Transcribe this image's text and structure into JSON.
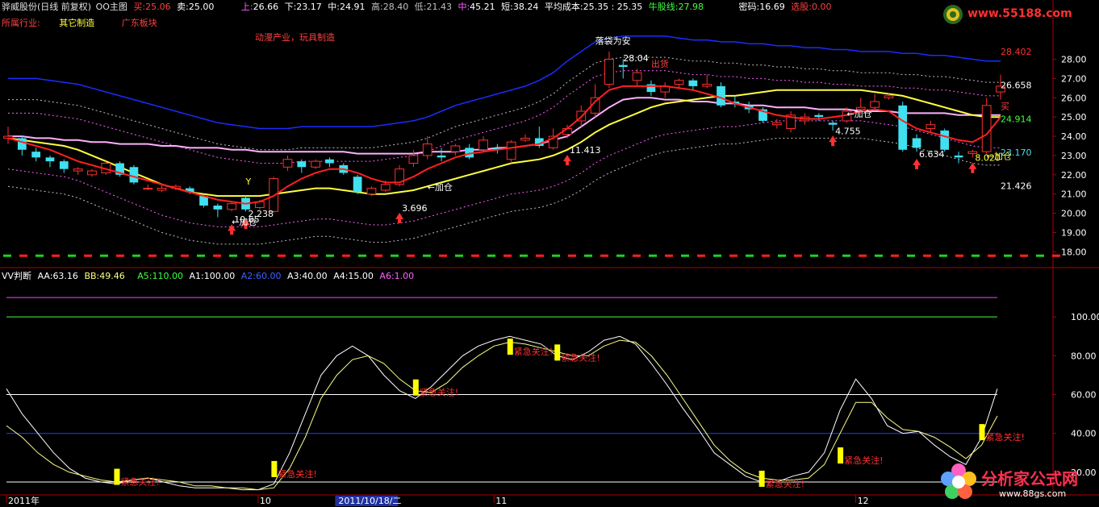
{
  "colors": {
    "bg": "#000000",
    "axis": "#b00000",
    "up": "#ff3030",
    "down": "#40e0f0",
    "ma_red": "#ff2020",
    "ma_yellow": "#ffff40",
    "ma_pink": "#ffb0ff",
    "upper_band": "#1a2cff",
    "dotted_pink": "#ff60ff",
    "dotted_white": "#c0c0c0",
    "k_line": "#ffffff",
    "d_line": "#ffff80",
    "alert": "#ffff00"
  },
  "header": {
    "stock": "骅威股份(日线 前复权)",
    "indicator": "OO主图",
    "buy_label": "买:",
    "buy_val": "25.06",
    "sell_label": "卖:",
    "sell_val": "25.00",
    "up_label": "上:",
    "up_val": "26.66",
    "down_label": "下:",
    "down_val": "23.17",
    "mid_label": "中:",
    "mid_val": "24.91",
    "high_label": "高:",
    "high_val": "28.40",
    "low_label": "低:",
    "low_val": "21.43",
    "zhong_label": "中:",
    "zhong_val": "45.21",
    "short_label": "短:",
    "short_val": "38.24",
    "avgcost_label": "平均成本:",
    "avgcost_val": "25.35 : 25.35",
    "bull_label": "牛股线:",
    "bull_val": "27.98",
    "code_label": "密码:",
    "code_val": "16.69",
    "pick_label": "选股:",
    "pick_val": "0.00"
  },
  "industry": {
    "label": "所属行业:",
    "value": "其它制造",
    "sector": "广东板块",
    "concept": "动漫产业，玩具制造"
  },
  "logo_top": "www.55188.com",
  "logo_bottom": {
    "brand": "分析家公式网",
    "url": "www.88gs.com"
  },
  "lower_header": {
    "name": "VV判断",
    "aa_label": "AA:",
    "aa_val": "63.16",
    "bb_label": "BB:",
    "bb_val": "49.46",
    "a5_label": "A5:",
    "a5_val": "110.00",
    "a1_label": "A1:",
    "a1_val": "100.00",
    "a2_label": "A2:",
    "a2_val": "60.00",
    "a3_label": "A3:",
    "a3_val": "40.00",
    "a4_label": "A4:",
    "a4_val": "15.00",
    "a6_label": "A6:",
    "a6_val": "1.00"
  },
  "chart_data": [
    {
      "type": "candlestick",
      "y_ticks": [
        "28.00",
        "27.00",
        "26.00",
        "25.00",
        "24.00",
        "23.00",
        "22.00",
        "21.00",
        "20.00",
        "19.00",
        "18.00"
      ],
      "ylim": [
        17.6,
        29.4
      ],
      "price_labels": [
        {
          "text": "28.402",
          "value": 28.4,
          "color": "#ff3030"
        },
        {
          "text": "26.658",
          "value": 26.66,
          "color": "#ffffff"
        },
        {
          "text": "24.914",
          "value": 24.91,
          "color": "#40ff40"
        },
        {
          "text": "23.170",
          "value": 23.17,
          "color": "#40e0f0"
        },
        {
          "text": "21.426",
          "value": 21.43,
          "color": "#ffffff"
        }
      ],
      "candles": [
        [
          23.9,
          24.0,
          24.5,
          23.6
        ],
        [
          23.9,
          23.3,
          24.0,
          23.0
        ],
        [
          23.2,
          22.9,
          23.4,
          22.7
        ],
        [
          22.9,
          22.7,
          23.0,
          22.4
        ],
        [
          22.7,
          22.3,
          22.8,
          22.1
        ],
        [
          22.2,
          22.3,
          22.4,
          22.0
        ],
        [
          22.0,
          22.2,
          22.3,
          21.9
        ],
        [
          22.1,
          22.6,
          22.7,
          22.0
        ],
        [
          22.6,
          22.0,
          22.7,
          21.9
        ],
        [
          22.4,
          21.6,
          22.5,
          21.5
        ],
        [
          21.3,
          21.3,
          21.5,
          21.2
        ],
        [
          21.2,
          21.3,
          21.5,
          21.1
        ],
        [
          21.3,
          21.4,
          21.5,
          21.2
        ],
        [
          21.3,
          21.1,
          21.4,
          21.0
        ],
        [
          20.9,
          20.4,
          21.0,
          20.3
        ],
        [
          20.4,
          20.2,
          20.5,
          19.8
        ],
        [
          20.2,
          20.5,
          20.6,
          20.1
        ],
        [
          20.8,
          20.2,
          20.9,
          20.1
        ],
        [
          20.3,
          20.6,
          20.7,
          20.2
        ],
        [
          20.1,
          21.8,
          21.9,
          20.0
        ],
        [
          22.4,
          22.8,
          23.0,
          22.2
        ],
        [
          22.7,
          22.4,
          22.8,
          22.1
        ],
        [
          22.4,
          22.7,
          22.8,
          22.3
        ],
        [
          22.8,
          22.6,
          22.9,
          22.4
        ],
        [
          22.5,
          22.1,
          22.6,
          22.0
        ],
        [
          21.9,
          21.1,
          22.0,
          21.0
        ],
        [
          21.0,
          21.3,
          21.4,
          20.9
        ],
        [
          21.2,
          21.5,
          21.7,
          21.1
        ],
        [
          21.5,
          22.3,
          22.5,
          21.4
        ],
        [
          22.6,
          23.0,
          23.3,
          22.4
        ],
        [
          23.0,
          23.6,
          24.0,
          22.8
        ],
        [
          23.0,
          22.9,
          23.4,
          22.7
        ],
        [
          23.2,
          23.5,
          23.6,
          23.0
        ],
        [
          23.4,
          22.9,
          23.6,
          22.8
        ],
        [
          23.3,
          23.8,
          24.0,
          23.2
        ],
        [
          23.4,
          23.3,
          23.6,
          23.1
        ],
        [
          22.8,
          23.7,
          23.8,
          22.6
        ],
        [
          23.8,
          23.9,
          24.1,
          23.7
        ],
        [
          23.9,
          23.5,
          24.5,
          23.4
        ],
        [
          23.4,
          24.0,
          24.4,
          23.3
        ],
        [
          24.1,
          24.4,
          24.6,
          23.9
        ],
        [
          24.8,
          25.3,
          25.6,
          24.5
        ],
        [
          25.2,
          26.0,
          26.7,
          25.0
        ],
        [
          26.7,
          28.0,
          28.4,
          26.5
        ],
        [
          27.7,
          27.6,
          28.0,
          27.0
        ],
        [
          26.9,
          27.3,
          27.5,
          26.6
        ],
        [
          26.7,
          26.3,
          26.9,
          26.1
        ],
        [
          26.3,
          26.6,
          26.8,
          26.0
        ],
        [
          26.7,
          26.9,
          27.0,
          26.5
        ],
        [
          26.9,
          26.6,
          27.0,
          26.4
        ],
        [
          26.6,
          26.7,
          27.2,
          26.5
        ],
        [
          26.6,
          25.6,
          26.8,
          25.5
        ],
        [
          25.8,
          25.7,
          26.1,
          25.5
        ],
        [
          25.6,
          25.4,
          25.8,
          25.2
        ],
        [
          25.4,
          24.8,
          25.5,
          24.7
        ],
        [
          24.6,
          24.7,
          24.9,
          24.4
        ],
        [
          24.4,
          25.1,
          25.3,
          24.2
        ],
        [
          24.8,
          25.0,
          25.2,
          24.6
        ],
        [
          25.1,
          25.0,
          25.2,
          24.8
        ],
        [
          24.7,
          24.6,
          24.8,
          24.3
        ],
        [
          24.8,
          25.3,
          25.5,
          24.7
        ],
        [
          25.4,
          25.5,
          26.0,
          25.2
        ],
        [
          25.5,
          25.8,
          26.2,
          25.4
        ],
        [
          26.0,
          26.1,
          26.2,
          25.9
        ],
        [
          25.6,
          23.3,
          25.8,
          23.2
        ],
        [
          23.9,
          23.4,
          24.1,
          23.2
        ],
        [
          24.4,
          24.6,
          24.8,
          24.2
        ],
        [
          24.3,
          23.3,
          24.4,
          23.2
        ],
        [
          23.0,
          22.9,
          23.2,
          22.6
        ],
        [
          23.1,
          23.2,
          23.3,
          22.9
        ],
        [
          23.2,
          25.6,
          26.0,
          23.1
        ],
        [
          26.3,
          26.6,
          27.2,
          25.9
        ]
      ],
      "ma_red": [
        23.9,
        23.7,
        23.5,
        23.3,
        23.0,
        22.7,
        22.5,
        22.3,
        22.1,
        21.9,
        21.7,
        21.5,
        21.3,
        21.1,
        20.9,
        20.7,
        20.6,
        20.5,
        20.6,
        20.9,
        21.4,
        21.8,
        22.1,
        22.3,
        22.3,
        22.1,
        21.8,
        21.6,
        21.6,
        21.9,
        22.3,
        22.6,
        22.9,
        23.1,
        23.2,
        23.3,
        23.4,
        23.5,
        23.6,
        23.9,
        24.4,
        25.0,
        25.8,
        26.4,
        26.6,
        26.6,
        26.6,
        26.6,
        26.5,
        26.4,
        26.2,
        26.0,
        25.7,
        25.5,
        25.3,
        25.1,
        25.0,
        24.9,
        24.9,
        25.0,
        25.1,
        25.3,
        25.4,
        25.3,
        24.8,
        24.4,
        24.2,
        24.0,
        23.8,
        23.7,
        24.1,
        25.0
      ],
      "ma_yellow": [
        23.9,
        23.8,
        23.7,
        23.6,
        23.5,
        23.3,
        23.0,
        22.7,
        22.4,
        22.1,
        21.8,
        21.5,
        21.3,
        21.1,
        21.0,
        20.9,
        20.9,
        20.9,
        20.9,
        21.0,
        21.1,
        21.2,
        21.3,
        21.3,
        21.2,
        21.1,
        21.0,
        21.0,
        21.1,
        21.2,
        21.4,
        21.6,
        21.8,
        22.0,
        22.2,
        22.4,
        22.6,
        22.7,
        22.8,
        23.0,
        23.3,
        23.7,
        24.2,
        24.6,
        24.9,
        25.2,
        25.5,
        25.7,
        25.8,
        25.9,
        26.0,
        26.1,
        26.1,
        26.2,
        26.3,
        26.4,
        26.4,
        26.4,
        26.4,
        26.4,
        26.4,
        26.4,
        26.3,
        26.2,
        26.1,
        25.9,
        25.7,
        25.5,
        25.3,
        25.1,
        25.0,
        25.0
      ],
      "ma_pink": [
        24.0,
        24.0,
        23.9,
        23.9,
        23.8,
        23.8,
        23.7,
        23.7,
        23.6,
        23.6,
        23.6,
        23.5,
        23.5,
        23.4,
        23.4,
        23.4,
        23.3,
        23.3,
        23.2,
        23.2,
        23.2,
        23.2,
        23.2,
        23.2,
        23.2,
        23.1,
        23.1,
        23.1,
        23.1,
        23.1,
        23.2,
        23.2,
        23.2,
        23.3,
        23.3,
        23.4,
        23.4,
        23.5,
        23.6,
        23.8,
        24.0,
        24.5,
        25.0,
        25.5,
        25.9,
        26.0,
        26.0,
        25.9,
        25.9,
        25.8,
        25.8,
        25.7,
        25.7,
        25.6,
        25.6,
        25.5,
        25.5,
        25.5,
        25.4,
        25.4,
        25.4,
        25.3,
        25.3,
        25.3,
        25.2,
        25.2,
        25.2,
        25.2,
        25.1,
        25.1,
        25.1,
        25.1
      ],
      "upper_band": [
        27.0,
        27.0,
        27.0,
        26.9,
        26.8,
        26.7,
        26.5,
        26.3,
        26.1,
        25.9,
        25.7,
        25.5,
        25.3,
        25.1,
        24.9,
        24.7,
        24.6,
        24.5,
        24.4,
        24.4,
        24.4,
        24.5,
        24.5,
        24.5,
        24.5,
        24.5,
        24.5,
        24.6,
        24.7,
        24.8,
        25.0,
        25.3,
        25.6,
        25.8,
        26.0,
        26.2,
        26.4,
        26.6,
        26.9,
        27.3,
        27.9,
        28.4,
        28.9,
        29.1,
        29.2,
        29.2,
        29.2,
        29.2,
        29.1,
        29.0,
        29.0,
        28.9,
        28.9,
        28.8,
        28.8,
        28.7,
        28.7,
        28.6,
        28.6,
        28.5,
        28.5,
        28.4,
        28.4,
        28.4,
        28.3,
        28.3,
        28.2,
        28.2,
        28.1,
        28.0,
        27.9,
        27.9
      ],
      "markers": [
        {
          "text": "10.65",
          "bar": 16,
          "value": 19.6,
          "color": "#ffffff"
        },
        {
          "text": "2.238",
          "bar": 17,
          "value": 19.9,
          "color": "#ffffff"
        },
        {
          "text": "3.696",
          "bar": 28,
          "value": 20.2,
          "color": "#ffffff"
        },
        {
          "text": "11.413",
          "bar": 40,
          "value": 23.2,
          "color": "#ffffff"
        },
        {
          "text": "4.755",
          "bar": 59,
          "value": 24.2,
          "color": "#ffffff"
        },
        {
          "text": "6.634",
          "bar": 65,
          "value": 23.0,
          "color": "#ffffff"
        },
        {
          "text": "8.020",
          "bar": 69,
          "value": 22.8,
          "color": "#ffff40"
        }
      ],
      "notes": [
        {
          "text": "←加仓",
          "bar": 16,
          "value": 19.4,
          "color": "#ffffff"
        },
        {
          "text": "←加仓",
          "bar": 30,
          "value": 21.2,
          "color": "#ffffff"
        },
        {
          "text": "←加仓",
          "bar": 60,
          "value": 25.0,
          "color": "#ffffff"
        },
        {
          "text": "←加仓",
          "bar": 70,
          "value": 22.8,
          "color": "#ffff40"
        },
        {
          "text": "落袋为安",
          "bar": 42,
          "value": 28.8,
          "color": "#ffffff"
        },
        {
          "text": "28.04",
          "bar": 44,
          "value": 27.9,
          "color": "#ffffff"
        },
        {
          "text": "出货",
          "bar": 46,
          "value": 27.6,
          "color": "#ff4040"
        },
        {
          "text": "买",
          "bar": 71,
          "value": 25.4,
          "color": "#ff4040"
        },
        {
          "text": "Y",
          "bar": 17,
          "value": 21.5,
          "color": "#ffff40"
        }
      ]
    },
    {
      "type": "line",
      "y_ticks": [
        "100.00",
        "80.00",
        "60.00",
        "40.00",
        "20.00"
      ],
      "ylim": [
        10,
        120
      ],
      "levels": [
        {
          "name": "A5",
          "value": 110,
          "color": "#ff40ff"
        },
        {
          "name": "A1",
          "value": 100,
          "color": "#40ff40"
        },
        {
          "name": "A2",
          "value": 60,
          "color": "#ffffff"
        },
        {
          "name": "A3",
          "value": 40,
          "color": "#2040ff"
        },
        {
          "name": "A4",
          "value": 15,
          "color": "#ffffff"
        }
      ],
      "series": [
        {
          "name": "AA",
          "values": [
            63,
            50,
            40,
            30,
            22,
            17,
            15,
            14,
            16,
            17,
            15,
            13,
            12,
            12,
            12,
            11,
            11,
            14,
            30,
            50,
            70,
            80,
            85,
            80,
            70,
            62,
            58,
            64,
            72,
            80,
            85,
            88,
            90,
            88,
            86,
            80,
            78,
            82,
            88,
            90,
            86,
            76,
            65,
            53,
            42,
            30,
            24,
            18,
            15,
            15,
            18,
            20,
            30,
            52,
            68,
            58,
            44,
            40,
            41,
            34,
            28,
            24,
            38,
            63
          ]
        },
        {
          "name": "BB",
          "values": [
            44,
            38,
            30,
            24,
            20,
            18,
            16,
            15,
            16,
            17,
            16,
            15,
            13,
            13,
            12,
            12,
            11,
            12,
            22,
            38,
            58,
            70,
            78,
            80,
            76,
            68,
            62,
            61,
            66,
            74,
            80,
            85,
            87,
            86,
            84,
            82,
            80,
            80,
            85,
            88,
            87,
            80,
            70,
            58,
            46,
            34,
            26,
            20,
            17,
            16,
            16,
            17,
            24,
            40,
            56,
            56,
            48,
            42,
            41,
            38,
            33,
            27,
            34,
            49
          ]
        }
      ],
      "alerts": [
        {
          "text": "紧急关注!",
          "index": 7,
          "value": 16
        },
        {
          "text": "紧急关注!",
          "index": 17,
          "value": 20
        },
        {
          "text": "紧急关注!",
          "index": 26,
          "value": 62
        },
        {
          "text": "紧急关注!",
          "index": 32,
          "value": 83
        },
        {
          "text": "紧急关注!",
          "index": 35,
          "value": 80
        },
        {
          "text": "紧急关注!",
          "index": 48,
          "value": 15
        },
        {
          "text": "紧急关注!",
          "index": 53,
          "value": 27
        },
        {
          "text": "紧急关注!",
          "index": 62,
          "value": 39
        }
      ],
      "x_ticks": [
        {
          "text": "2011年",
          "index": 0
        },
        {
          "text": "10",
          "index": 16
        },
        {
          "text": "2011/10/18/二",
          "index": 21
        },
        {
          "text": "11",
          "index": 31
        },
        {
          "text": "12",
          "index": 54
        }
      ]
    }
  ]
}
